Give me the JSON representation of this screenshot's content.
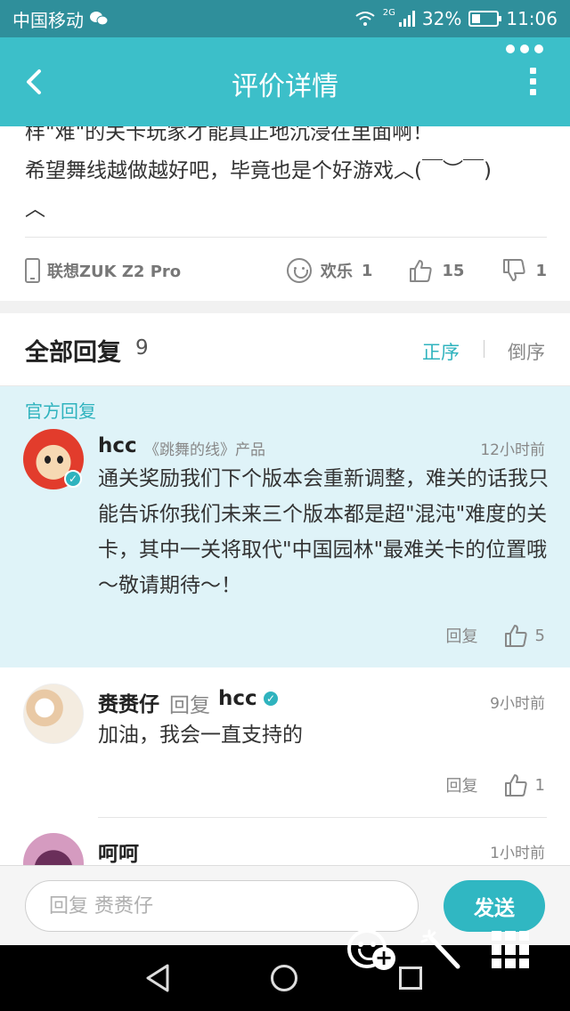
{
  "status_bar": {
    "carrier": "中国移动",
    "network": "2G",
    "battery": "32%",
    "battery_level": 0.32,
    "time": "11:06"
  },
  "header": {
    "title": "评价详情"
  },
  "review": {
    "line1": "样\"难\"的关卡玩家才能真正地沉浸在里面啊！",
    "line2": "希望舞线越做越好吧，毕竟也是个好游戏︿(￣︶￣)",
    "line3": "︿",
    "device": "联想ZUK Z2 Pro",
    "happy_label": "欢乐",
    "happy_count": "1",
    "likes": "15",
    "dislikes": "1"
  },
  "replies": {
    "title": "全部回复",
    "count": "9",
    "sort_asc": "正序",
    "sort_desc": "倒序"
  },
  "official_reply": {
    "tag": "官方回复",
    "author": "hcc",
    "product": "《跳舞的线》产品",
    "time": "12小时前",
    "content": "通关奖励我们下个版本会重新调整，难关的话我只能告诉你我们未来三个版本都是超\"混沌\"难度的关卡，其中一关将取代\"中国园林\"最难关卡的位置哦～敬请期待～！",
    "reply_label": "回复",
    "likes": "5"
  },
  "comments": [
    {
      "author": "赉赉仔",
      "reply_word": "回复",
      "reply_to": "hcc",
      "time": "9小时前",
      "content": "加油，我会一直支持的",
      "reply_label": "回复",
      "likes": "1"
    },
    {
      "author": "呵呵",
      "time": "1小时前"
    }
  ],
  "input_bar": {
    "placeholder": "回复 赉赉仔",
    "send_label": "发送"
  },
  "colors": {
    "header": "#3cbfc9",
    "status_bar": "#2f8f9b",
    "accent": "#2fb3be",
    "official_bg": "#dff3f8"
  }
}
